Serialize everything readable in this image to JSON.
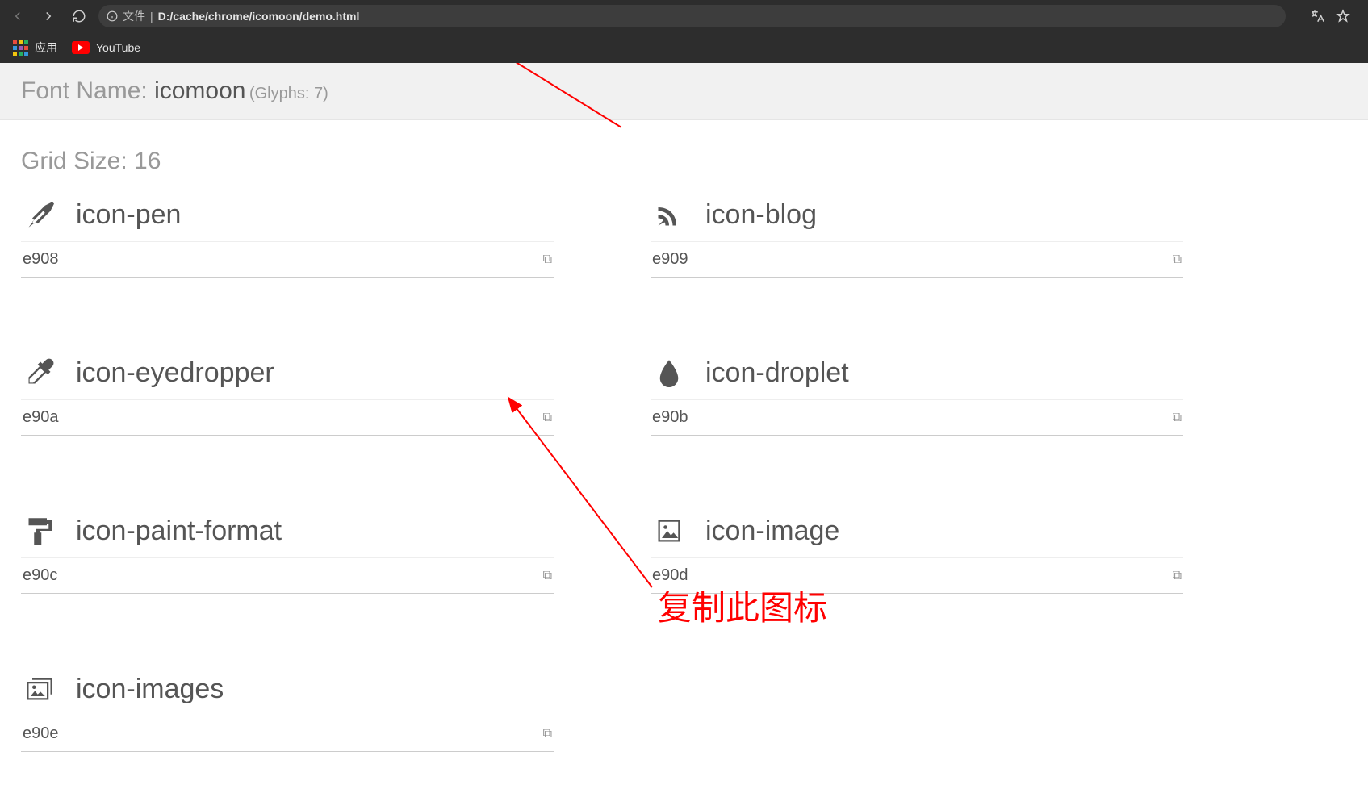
{
  "browser": {
    "address_prefix": "文件",
    "address_url": "D:/cache/chrome/icomoon/demo.html",
    "bookmarks": {
      "apps": "应用",
      "youtube": "YouTube"
    }
  },
  "header": {
    "label": "Font Name: ",
    "font_name": "icomoon",
    "glyphs": "(Glyphs: 7)"
  },
  "grid_size_label": "Grid Size: 16",
  "glyphs": [
    {
      "name": "icon-pen",
      "code": "e908",
      "icon": "pen",
      "copy": "⧉"
    },
    {
      "name": "icon-blog",
      "code": "e909",
      "icon": "blog",
      "copy": "⧉"
    },
    {
      "name": "icon-eyedropper",
      "code": "e90a",
      "icon": "eyedropper",
      "copy": "⧉"
    },
    {
      "name": "icon-droplet",
      "code": "e90b",
      "icon": "droplet",
      "copy": "⧉"
    },
    {
      "name": "icon-paint-format",
      "code": "e90c",
      "icon": "paint-format",
      "copy": "⧉"
    },
    {
      "name": "icon-image",
      "code": "e90d",
      "icon": "image",
      "copy": "⧉"
    },
    {
      "name": "icon-images",
      "code": "e90e",
      "icon": "images",
      "copy": "⧉"
    }
  ],
  "annotation": {
    "text": "复制此图标"
  }
}
